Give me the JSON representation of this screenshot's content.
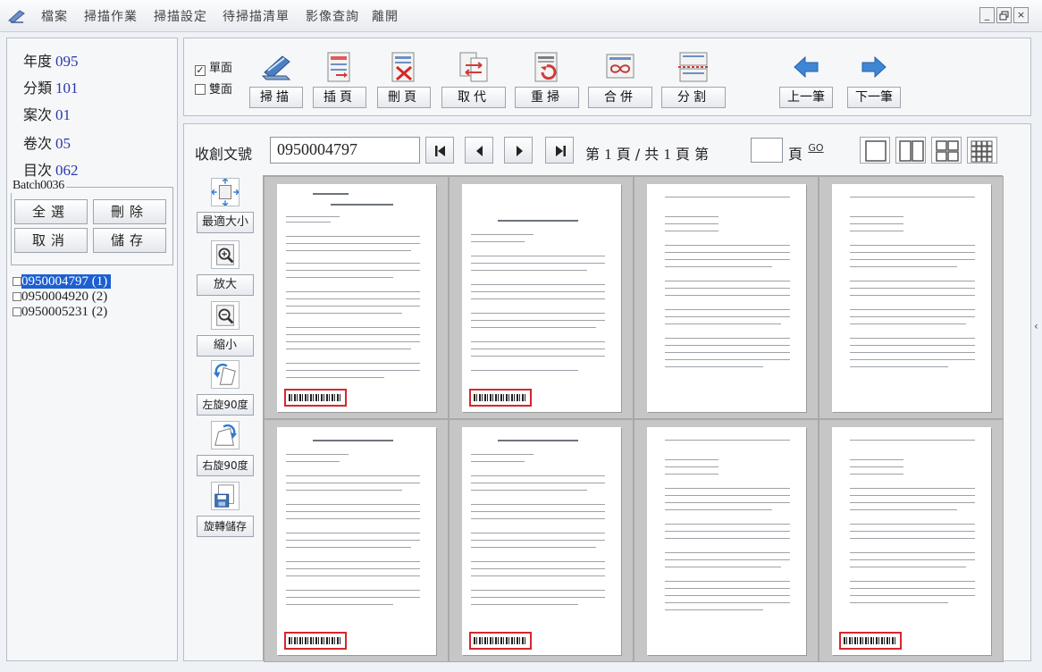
{
  "menu": {
    "items": [
      "檔案",
      "掃描作業",
      "掃描設定",
      "待掃描清單",
      "影像查詢",
      "離開"
    ],
    "window_buttons": [
      "_",
      "🗗",
      "×"
    ]
  },
  "info": [
    {
      "label": "年度",
      "value": "095"
    },
    {
      "label": "分類",
      "value": "101"
    },
    {
      "label": "案次",
      "value": "01"
    },
    {
      "label": "卷次",
      "value": "05"
    },
    {
      "label": "目次",
      "value": "062"
    }
  ],
  "batch": {
    "title": "Batch0036",
    "select_all": "全選",
    "delete": "刪除",
    "cancel": "取消",
    "save": "儲存"
  },
  "documents": [
    {
      "label": "0950004797 (1)",
      "selected": true
    },
    {
      "label": "0950004920 (2)",
      "selected": false
    },
    {
      "label": "0950005231 (2)",
      "selected": false
    }
  ],
  "toolbar": {
    "single_side": "單面",
    "double_side": "雙面",
    "single_checked": true,
    "double_checked": false,
    "buttons": [
      "掃描",
      "插頁",
      "刪頁",
      "取代",
      "重掃",
      "合併",
      "分割",
      "上一筆",
      "下一筆"
    ]
  },
  "viewer": {
    "doc_no_label": "收創文號",
    "doc_no_value": "0950004797",
    "page_prefix": "第",
    "current_page": "1",
    "page_mid": "頁 / 共",
    "total_pages": "1",
    "page_suffix": "頁",
    "goto_prefix": "第",
    "goto_value": "",
    "goto_suffix": "頁",
    "go_label": "GO"
  },
  "side_tools": [
    "最適大小",
    "放大",
    "縮小",
    "左旋90度",
    "右旋90度",
    "旋轉儲存"
  ],
  "thumbnails": [
    {
      "barcode_highlighted": true
    },
    {
      "barcode_highlighted": true
    },
    {
      "barcode_highlighted": false
    },
    {
      "barcode_highlighted": false
    },
    {
      "barcode_highlighted": true
    },
    {
      "barcode_highlighted": true
    },
    {
      "barcode_highlighted": false
    },
    {
      "barcode_highlighted": true
    }
  ],
  "colors": {
    "selection": "#1c5fd0",
    "info_value": "#2a37a8",
    "barcode_highlight": "#d6272c"
  }
}
